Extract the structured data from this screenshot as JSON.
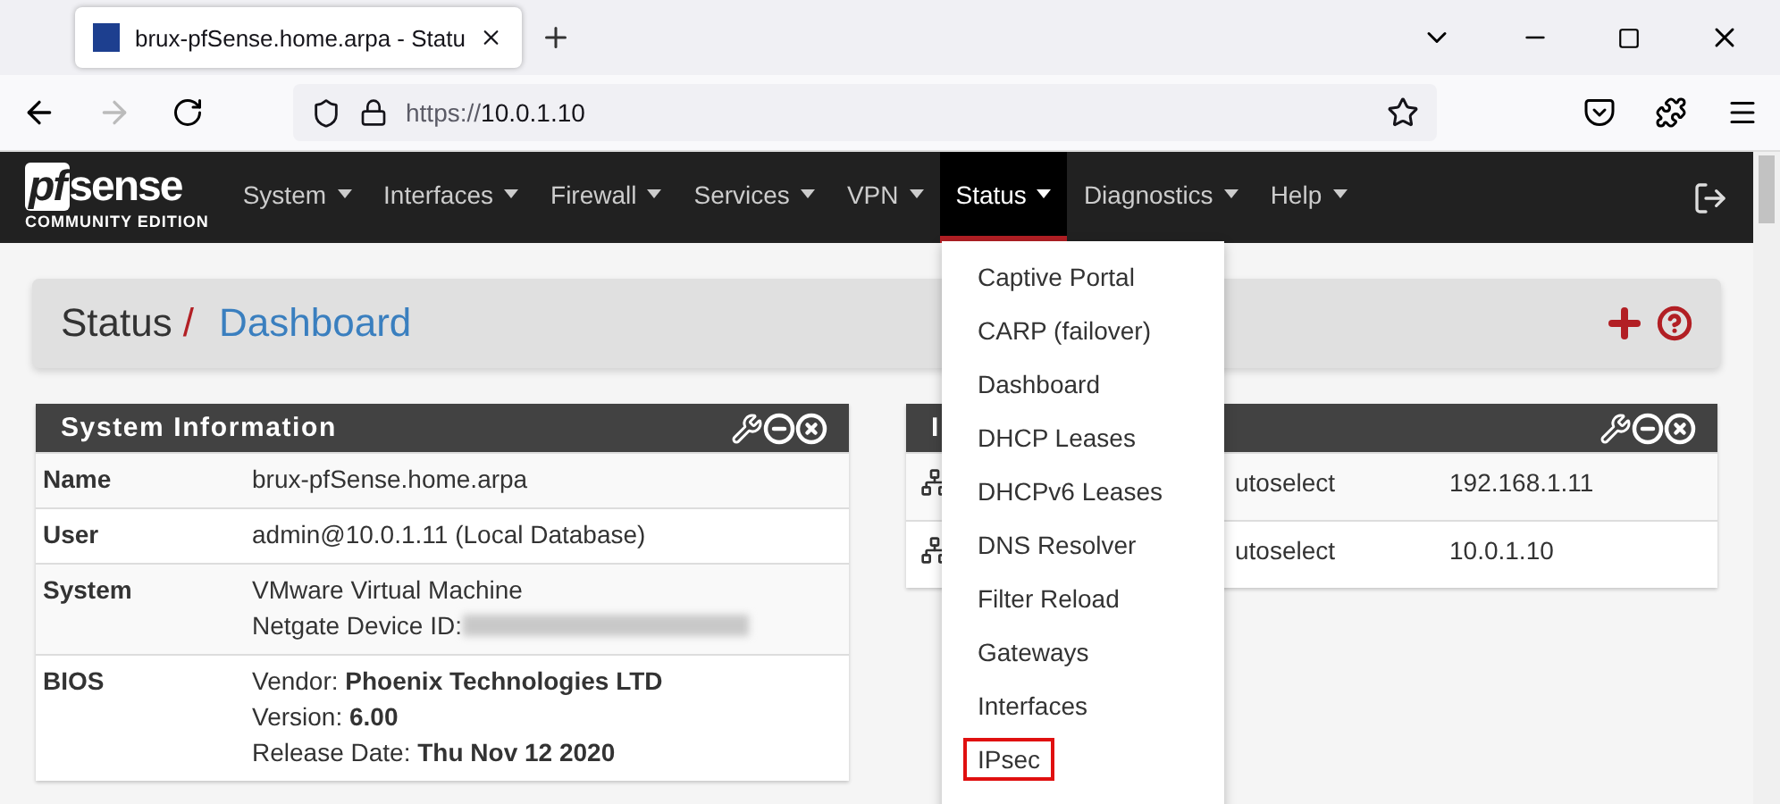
{
  "browser": {
    "tab_title": "brux-pfSense.home.arpa - Statu",
    "url_scheme": "https://",
    "url_host": "10.0.1.10"
  },
  "navbar": {
    "logo_main": "pf",
    "logo_rest": "sense",
    "logo_sub": "COMMUNITY EDITION",
    "items": [
      {
        "label": "System",
        "selected": false
      },
      {
        "label": "Interfaces",
        "selected": false
      },
      {
        "label": "Firewall",
        "selected": false
      },
      {
        "label": "Services",
        "selected": false
      },
      {
        "label": "VPN",
        "selected": false
      },
      {
        "label": "Status",
        "selected": true
      },
      {
        "label": "Diagnostics",
        "selected": false
      },
      {
        "label": "Help",
        "selected": false
      }
    ]
  },
  "status_menu": [
    {
      "label": "Captive Portal",
      "highlighted": false
    },
    {
      "label": "CARP (failover)",
      "highlighted": false
    },
    {
      "label": "Dashboard",
      "highlighted": false
    },
    {
      "label": "DHCP Leases",
      "highlighted": false
    },
    {
      "label": "DHCPv6 Leases",
      "highlighted": false
    },
    {
      "label": "DNS Resolver",
      "highlighted": false
    },
    {
      "label": "Filter Reload",
      "highlighted": false
    },
    {
      "label": "Gateways",
      "highlighted": false
    },
    {
      "label": "Interfaces",
      "highlighted": false
    },
    {
      "label": "IPsec",
      "highlighted": true
    }
  ],
  "breadcrumb": {
    "section": "Status",
    "separator": "/",
    "page": "Dashboard"
  },
  "system_information": {
    "title": "System Information",
    "rows": [
      {
        "label": "Name",
        "lines": [
          "brux-pfSense.home.arpa"
        ]
      },
      {
        "label": "User",
        "lines": [
          "admin@10.0.1.11 (Local Database)"
        ]
      },
      {
        "label": "System",
        "lines": [
          "VMware Virtual Machine",
          "Netgate Device ID: "
        ],
        "redacted": true
      },
      {
        "label": "BIOS",
        "lines": [
          "Vendor: **Phoenix Technologies LTD**",
          "Version: **6.00**",
          "Release Date: **Thu Nov 12 2020**"
        ]
      }
    ]
  },
  "interfaces_widget": {
    "title": "I",
    "rows": [
      {
        "media": "utoselect",
        "address": "192.168.1.11"
      },
      {
        "media": "utoselect",
        "address": "10.0.1.10"
      }
    ]
  }
}
